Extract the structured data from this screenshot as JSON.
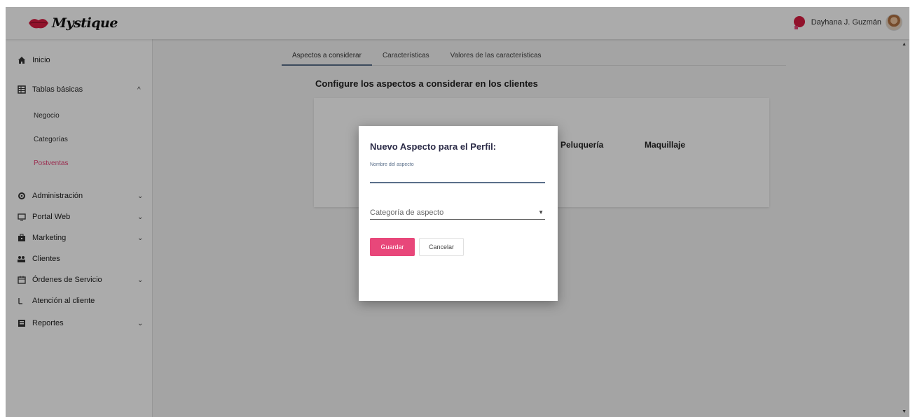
{
  "header": {
    "logo_text": "Mystique",
    "user_name": "Dayhana J. Guzmán"
  },
  "sidebar": {
    "items": [
      {
        "label": "Inicio",
        "icon": "home-icon"
      },
      {
        "label": "Tablas básicas",
        "icon": "table-icon",
        "chevron": "^"
      },
      {
        "label": "Administración",
        "icon": "gear-icon",
        "chevron": "⌄"
      },
      {
        "label": "Portal Web",
        "icon": "monitor-icon",
        "chevron": "⌄"
      },
      {
        "label": "Marketing",
        "icon": "megaphone-icon",
        "chevron": "⌄"
      },
      {
        "label": "Clientes",
        "icon": "users-icon"
      },
      {
        "label": "Órdenes de Servicio",
        "icon": "calendar-icon",
        "chevron": "⌄"
      },
      {
        "label": "Atención al cliente",
        "icon": "headset-icon"
      },
      {
        "label": "Reportes",
        "icon": "report-icon",
        "chevron": "⌄"
      }
    ],
    "subitems": [
      {
        "label": "Negocio"
      },
      {
        "label": "Categorías"
      },
      {
        "label": "Postventas"
      }
    ]
  },
  "main": {
    "tabs": [
      {
        "label": "Aspectos a considerar"
      },
      {
        "label": "Características"
      },
      {
        "label": "Valores de las características"
      }
    ],
    "heading": "Configure los aspectos a considerar en los clientes",
    "aspects": [
      "Peluquería",
      "Maquillaje"
    ]
  },
  "modal": {
    "title": "Nuevo Aspecto para el Perfil:",
    "name_label": "Nombre del aspecto",
    "name_value": "",
    "category_placeholder": "Categoría de aspecto",
    "save_label": "Guardar",
    "cancel_label": "Cancelar"
  },
  "colors": {
    "accent": "#e8477a",
    "primary": "#5a6f8a",
    "overlay": "rgba(0,0,0,0.33)"
  }
}
